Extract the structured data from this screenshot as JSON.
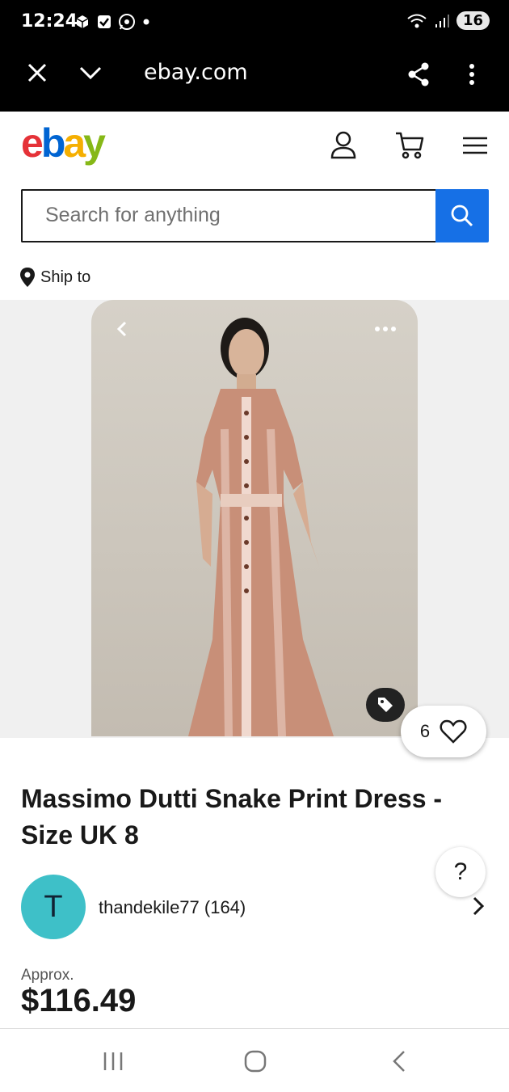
{
  "status": {
    "time": "12:24",
    "battery": "16"
  },
  "browser": {
    "url": "ebay.com"
  },
  "header": {
    "logo": [
      "e",
      "b",
      "a",
      "y"
    ],
    "logo_colors": [
      "#e53238",
      "#0064d2",
      "#f5af02",
      "#86b817"
    ]
  },
  "search": {
    "placeholder": "Search for anything",
    "button_color": "#1670e6"
  },
  "ship": {
    "label": "Ship to"
  },
  "listing": {
    "watch_count": "6",
    "title": "Massimo Dutti Snake Print Dress - Size UK 8",
    "seller_initial": "T",
    "seller_name": "thandekile77 (164)",
    "price_prefix": "Approx.",
    "price": "$116.49"
  },
  "help": {
    "label": "?"
  }
}
